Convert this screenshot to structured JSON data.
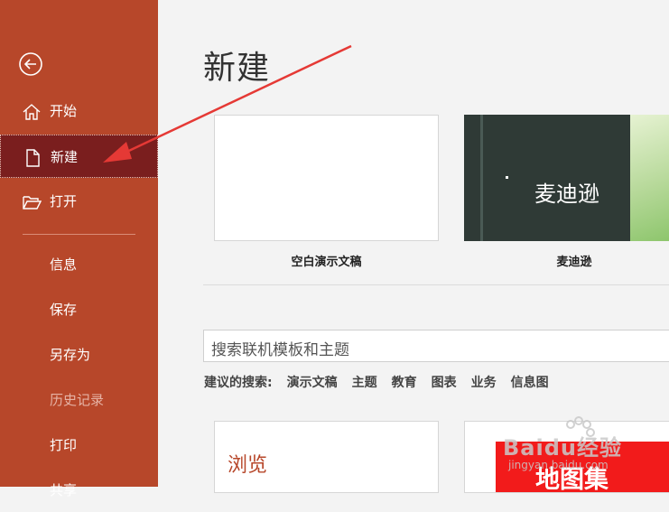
{
  "sidebar": {
    "back_icon": "back-arrow-icon",
    "items": [
      {
        "label": "开始",
        "icon": "home-icon"
      },
      {
        "label": "新建",
        "icon": "new-document-icon"
      },
      {
        "label": "打开",
        "icon": "open-folder-icon"
      },
      {
        "label": "信息"
      },
      {
        "label": "保存"
      },
      {
        "label": "另存为"
      },
      {
        "label": "历史记录"
      },
      {
        "label": "打印"
      },
      {
        "label": "共享"
      }
    ],
    "active": "新建",
    "colors": {
      "background": "#b7472a",
      "active": "#7a1e1e"
    }
  },
  "main": {
    "title": "新建",
    "templates": [
      {
        "label": "空白演示文稿"
      },
      {
        "label": "麦迪逊",
        "preview_text": "麦迪逊"
      }
    ],
    "search": {
      "placeholder": "搜索联机模板和主题"
    },
    "suggestions": {
      "lead": "建议的搜索:",
      "items": [
        "演示文稿",
        "主题",
        "教育",
        "图表",
        "业务",
        "信息图"
      ]
    },
    "more_templates": [
      {
        "preview_text": "浏览"
      },
      {
        "preview_text": "地图集"
      }
    ]
  },
  "watermark": {
    "brand": "Baidu经验",
    "url": "jingyan.baidu.com"
  },
  "annotation": {
    "type": "red-arrow",
    "color": "#e53935"
  }
}
